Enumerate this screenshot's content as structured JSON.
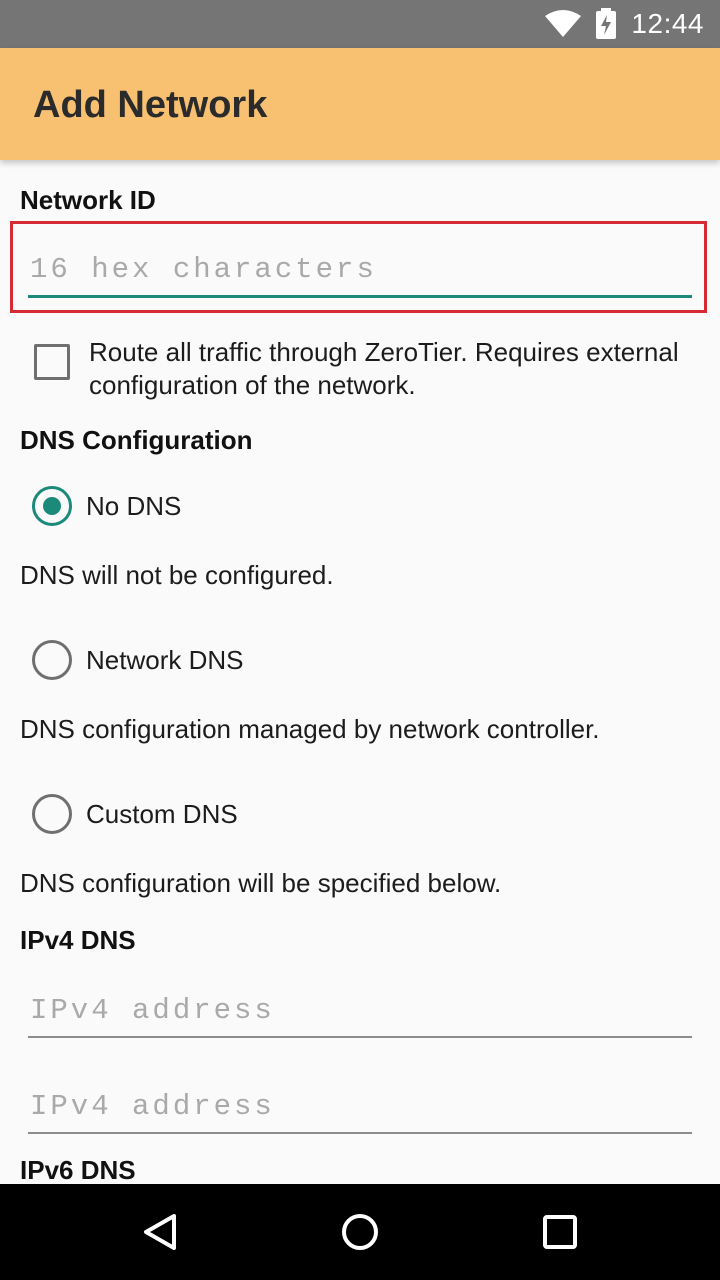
{
  "status_bar": {
    "time": "12:44",
    "icons": [
      "wifi-icon",
      "battery-charging-icon"
    ]
  },
  "app_bar": {
    "title": "Add Network",
    "color": "#f8c172"
  },
  "network_id": {
    "label": "Network ID",
    "placeholder": "16 hex characters",
    "value": ""
  },
  "route_all": {
    "checked": false,
    "label": "Route all traffic through ZeroTier. Requires external configuration of the network."
  },
  "dns": {
    "label": "DNS Configuration",
    "options": [
      {
        "label": "No DNS",
        "description": "DNS will not be configured.",
        "selected": true
      },
      {
        "label": "Network DNS",
        "description": "DNS configuration managed by network controller.",
        "selected": false
      },
      {
        "label": "Custom DNS",
        "description": "DNS configuration will be specified below.",
        "selected": false
      }
    ]
  },
  "ipv4_dns": {
    "label": "IPv4 DNS",
    "fields": [
      {
        "placeholder": "IPv4 address",
        "value": ""
      },
      {
        "placeholder": "IPv4 address",
        "value": ""
      }
    ]
  },
  "ipv6_dns": {
    "label": "IPv6 DNS"
  },
  "colors": {
    "accent": "#1b8a7a",
    "highlight": "#d62b34",
    "status_bar": "#757575"
  },
  "nav": [
    "back-icon",
    "home-icon",
    "recents-icon"
  ]
}
